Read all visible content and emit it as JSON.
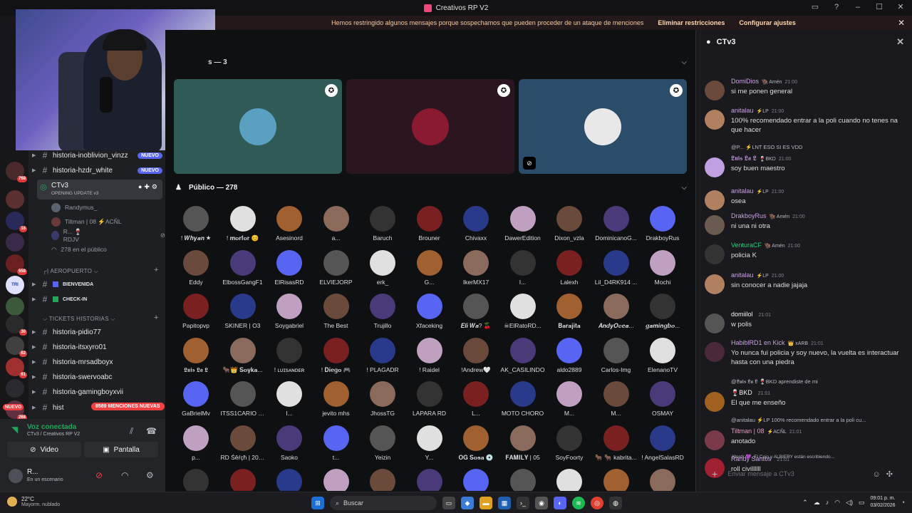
{
  "window": {
    "title": "Creativos RP V2"
  },
  "banner": {
    "message": "Hemos restringido algunos mensajes porque sospechamos que pueden proceder de un ataque de menciones",
    "action1": "Eliminar restricciones",
    "action2": "Configurar ajustes"
  },
  "guild_badges": [
    "768",
    "16",
    "558",
    "30",
    "62",
    "61",
    "268"
  ],
  "nuevo_pill": "NUEVO",
  "sidebar": {
    "channels_top": [
      {
        "name": "historia-inoblivion_vinzz",
        "badge": "NUEVO"
      },
      {
        "name": "historia-hzdr_white",
        "badge": "NUEVO"
      }
    ],
    "voice_channel": {
      "name": "CTv3",
      "subtitle": "OPENING UPDATE v3"
    },
    "voice_users": [
      "Randymus_",
      "Tiltman | 08 ⚡ACÑL",
      "R... 🍷RDJV"
    ],
    "audience": "278 en el público",
    "category1": "AEROPUERTO",
    "cat1_channels": [
      "BIENVENIDA",
      "CHECK-IN"
    ],
    "category2": "TICKETS HISTORIAS",
    "cat2_channels": [
      "historia-pidio77",
      "historia-itsxyro01",
      "historia-mrsadboyx",
      "historia-swervoabc",
      "historia-gamingboyxvii",
      "hist"
    ],
    "mentions_pill": "8589 MENCIONES NUEVAS"
  },
  "voice_panel": {
    "status": "Voz conectada",
    "location": "CTv3 / Creativos RP V2",
    "video_label": "Video",
    "screen_label": "Pantalla"
  },
  "user": {
    "name": "R...",
    "status": "En un escenario"
  },
  "stage": {
    "speakers_label": "s — 3",
    "public_label": "Público — 278"
  },
  "audience": [
    "! 𝑾𝒉𝒚𝒂𝒏 ★",
    "! 𝐦𝐨𝐫𝐟𝐨𝐫 😊",
    "Asesinord",
    "a...",
    "Baruch",
    "Brouner",
    "Chivaxx",
    "DawerEdition",
    "Dixon_vzla",
    "DominicanoG...",
    "DrakboyRus",
    "Eddy",
    "ElbossGangF1",
    "ElRisasRD",
    "ELVIEJORP",
    "erk_",
    "G...",
    "IkerMX17",
    "I...",
    "Lalexh",
    "Lil_D4RK914 ...",
    "Mochi",
    "Papitopvp",
    "SKINER | O3",
    "Soygabriel",
    "The Best",
    "Trujillo",
    "Xfaceking",
    "𝑬𝒍𝒊 𝑾𝒂? 🍒",
    "☠ElRatoRD...",
    "𝐁𝐚𝐫𝐚𝐣𝐢𝐭𝐚",
    "𝑨𝒏𝒅𝒚𝑶𝒄𝒆𝒂...",
    "𝒈𝒂𝒎𝒊𝒏𝒈𝒃𝒐...",
    "𝕷𝖚𝖎𝖘 𝕷𝖆 𝕷",
    "🐂👑 𝐒𝐨𝐲𝐤𝐚...",
    "! ʟᴜɪsᴀɴᴅᴇʀ",
    "! 𝐃𝐢𝐞𝐠𝐨 🎮",
    "! PLAGADR",
    "! Raidel",
    "!Andrew🤍",
    "AK_CASILINDO",
    "aldo2889",
    "Carlos-Img",
    "ElenanoTV",
    "GaBrielMv",
    "ITSS1CARIO O...",
    "I...",
    "jevito mhs",
    "JhossTG",
    "LAPARA RD",
    "L...",
    "MOTO CHORO",
    "M...",
    "M...",
    "OSMAY",
    "p...",
    "RD Śêŕçħ | 20 ...",
    "Saoko",
    "t...",
    "Yeizin",
    "Y...",
    "𝐎𝐆 𝐒𝐨𝐬𝐚 💿",
    "𝐅𝐀𝐌𝐈𝐋𝐘 | 05",
    "SoyFoorty",
    "🐂 🐂 kabrita...",
    "! AngelSalasRD",
    "",
    "",
    "",
    "",
    "",
    "",
    "",
    "",
    "",
    "",
    ""
  ],
  "chat": {
    "channel": "CTv3",
    "messages": [
      {
        "author": "DomiDios",
        "tags": "🦬 Amén",
        "time": "21:00",
        "text": "si me ponen general"
      },
      {
        "author": "anitalau",
        "tags": "⚡LP",
        "time": "21:00",
        "text": "100% recomendado entrar a la poli cuando no tenes na que hacer"
      },
      {
        "reply": "@P... ⚡LNT ESO SI ES VDD",
        "author": "𝕷𝖚𝖎𝖘 𝕷𝖆 𝕷",
        "tags": "🍷BKD",
        "time": "21:00",
        "text": "soy buen maestro"
      },
      {
        "author": "anitalau",
        "tags": "⚡LP",
        "time": "21:00",
        "text": "osea"
      },
      {
        "author": "DrakboyRus",
        "tags": "🦬 Amén",
        "time": "21:00",
        "text": "ni una ni otra"
      },
      {
        "author": "VenturaCF",
        "tags": "🦬 Amén",
        "time": "21:00",
        "text": "policia K"
      },
      {
        "author": "anitalau",
        "tags": "⚡LP",
        "time": "21:00",
        "text": "sin conocer a nadie jajaja"
      },
      {
        "author": "domiilol",
        "tags": "",
        "time": "21:01",
        "text": "w polis"
      },
      {
        "author": "HabiblRD1 en Kick",
        "tags": "👑 xARB",
        "time": "21:01",
        "text": "Yo nunca fui policia y soy nuevo, la vuelta es interactuar hasta con una piedra"
      },
      {
        "reply": "@𝕷𝖚𝖎𝖘 𝕷𝖆 𝕷 🍷BKD aprendiste de mi",
        "author": "🍷BKD",
        "tags": "",
        "time": "21:01",
        "text": "El que me enseño"
      },
      {
        "reply": "@anitalau ⚡LP 100% recomendado entrar a la poli cu...",
        "author": "Tiltman | 08",
        "tags": "⚡ACÑL",
        "time": "21:01",
        "text": "anotado"
      },
      {
        "author": "Randy Santos",
        "tags": "",
        "time": "21:01",
        "text": "roll civillllll"
      }
    ],
    "typing": "Xterdr 💜, El Cojo y ALBIERY están escribiendo...",
    "input_placeholder": "Enviar mensaje a CTv3"
  },
  "taskbar": {
    "temp": "22°C",
    "weather": "Mayorm. nublado",
    "search": "Buscar",
    "time": "09:01 p. m.",
    "date": "03/02/2026"
  },
  "colors": {
    "accent": "#5865f2",
    "green": "#23a55a",
    "danger": "#f23f42"
  }
}
